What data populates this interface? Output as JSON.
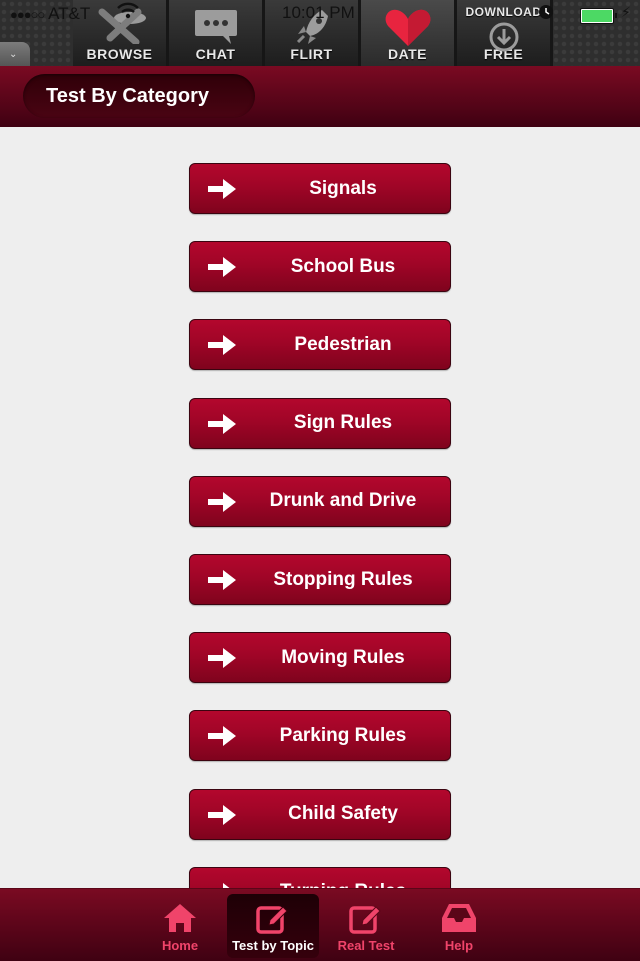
{
  "status_bar": {
    "signal": "●●●○○",
    "carrier": "AT&T",
    "time": "10:01 PM",
    "battery_level": 1.0,
    "charging": true
  },
  "ad_banner": {
    "tabs": [
      {
        "label": "BROWSE",
        "icon": "browse-icon",
        "selected": false
      },
      {
        "label": "CHAT",
        "icon": "chat-bubble-icon",
        "selected": false
      },
      {
        "label": "FLIRT",
        "icon": "rocket-icon",
        "selected": false
      },
      {
        "label": "DATE",
        "icon": "heart-icon",
        "selected": true
      },
      {
        "label": "FREE",
        "icon": "download-icon",
        "selected": false,
        "top_label": "DOWNLOAD"
      }
    ],
    "colors": {
      "heart": "#e8243f"
    }
  },
  "header": {
    "title": "Test By Category"
  },
  "categories": [
    {
      "label": "Signals"
    },
    {
      "label": "School Bus"
    },
    {
      "label": "Pedestrian"
    },
    {
      "label": "Sign Rules"
    },
    {
      "label": "Drunk and Drive"
    },
    {
      "label": "Stopping Rules"
    },
    {
      "label": "Moving Rules"
    },
    {
      "label": "Parking Rules"
    },
    {
      "label": "Child Safety"
    },
    {
      "label": "Turning Rules"
    }
  ],
  "tabbar": {
    "tabs": [
      {
        "label": "Home",
        "icon": "home-icon",
        "active": false
      },
      {
        "label": "Test by Topic",
        "icon": "edit-icon",
        "active": true
      },
      {
        "label": "Real Test",
        "icon": "edit-icon",
        "active": false
      },
      {
        "label": "Help",
        "icon": "inbox-tray-icon",
        "active": false
      }
    ]
  },
  "colors": {
    "brand_red": "#a00527",
    "header_top": "#7a0a22",
    "header_bottom": "#3f0112",
    "tab_icon": "#f0446a",
    "background": "#eeeeee"
  }
}
